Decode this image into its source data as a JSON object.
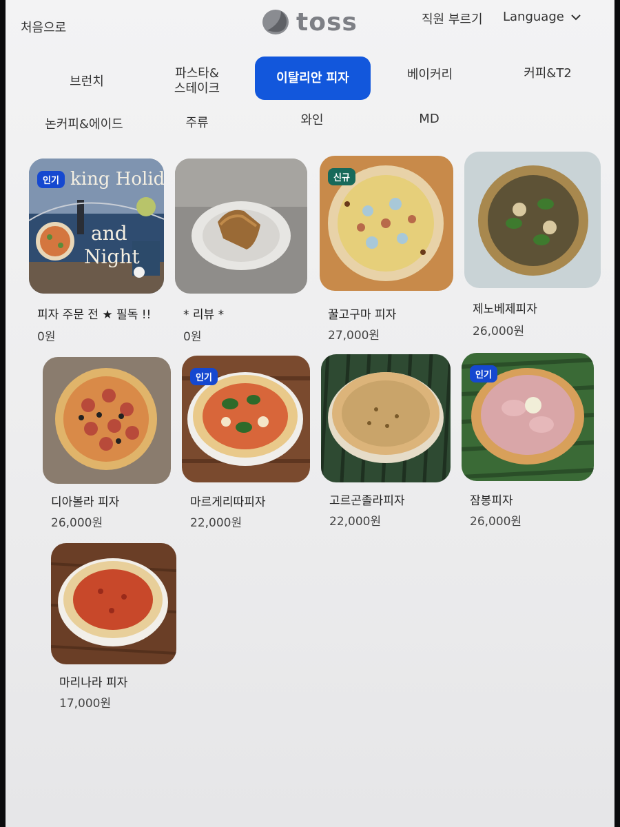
{
  "header": {
    "home_label": "처음으로",
    "logo_text": "toss",
    "call_staff_label": "직원 부르기",
    "language_label": "Language"
  },
  "categories": [
    {
      "label": "브런치",
      "active": false
    },
    {
      "label": "파스타&\n스테이크",
      "active": false
    },
    {
      "label": "이탈리안 피자",
      "active": true
    },
    {
      "label": "베이커리",
      "active": false
    },
    {
      "label": "커피&T2",
      "active": false
    },
    {
      "label": "논커피&에이드",
      "active": false
    },
    {
      "label": "주류",
      "active": false
    },
    {
      "label": "와인",
      "active": false
    },
    {
      "label": "MD",
      "active": false
    }
  ],
  "badges": {
    "hot": "인기",
    "new": "신규"
  },
  "promo_text": {
    "line1": "king Holiday",
    "line2": "and",
    "line3": "Night"
  },
  "products": [
    {
      "name": "피자 주문 전 ★ 필독 !!",
      "price": "0원",
      "badge": "인기",
      "image": "holiday-night-promo"
    },
    {
      "name": "* 리뷰 *",
      "price": "0원",
      "badge": "",
      "image": "pound-cake-on-plate"
    },
    {
      "name": "꿀고구마 피자",
      "price": "27,000원",
      "badge": "신규",
      "image": "sweet-potato-pizza"
    },
    {
      "name": "제노베제피자",
      "price": "26,000원",
      "badge": "",
      "image": "genovese-pizza"
    },
    {
      "name": "디아볼라 피자",
      "price": "26,000원",
      "badge": "",
      "image": "diavola-pizza"
    },
    {
      "name": "마르게리따피자",
      "price": "22,000원",
      "badge": "인기",
      "image": "margherita-pizza"
    },
    {
      "name": "고르곤졸라피자",
      "price": "22,000원",
      "badge": "",
      "image": "gorgonzola-pizza"
    },
    {
      "name": "잠봉피자",
      "price": "26,000원",
      "badge": "인기",
      "image": "jambon-pizza"
    },
    {
      "name": "마리나라 피자",
      "price": "17,000원",
      "badge": "",
      "image": "marinara-pizza"
    }
  ],
  "colors": {
    "accent": "#1257dc",
    "badge_hot": "#1548d0",
    "badge_new": "#17695a"
  }
}
